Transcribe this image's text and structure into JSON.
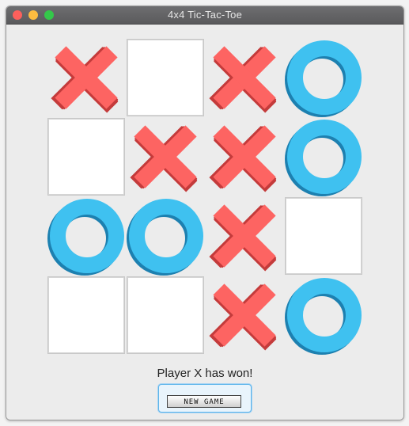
{
  "window": {
    "title": "4x4 Tic-Tac-Toe",
    "traffic_colors": {
      "close": "#fc605c",
      "minimize": "#fdbc40",
      "zoom": "#34c84a"
    }
  },
  "board": {
    "rows": [
      [
        "X",
        "",
        "X",
        "O"
      ],
      [
        "",
        "X",
        "X",
        "O"
      ],
      [
        "O",
        "O",
        "X",
        ""
      ],
      [
        "",
        "",
        "X",
        "O"
      ]
    ],
    "colors": {
      "x_face": "#fd6462",
      "x_side": "#c43b3b",
      "o_face": "#3fc1f0",
      "o_side": "#1d80b0"
    }
  },
  "status": {
    "text": "Player X has won!"
  },
  "new_game_button": {
    "label": "NEW GAME"
  }
}
